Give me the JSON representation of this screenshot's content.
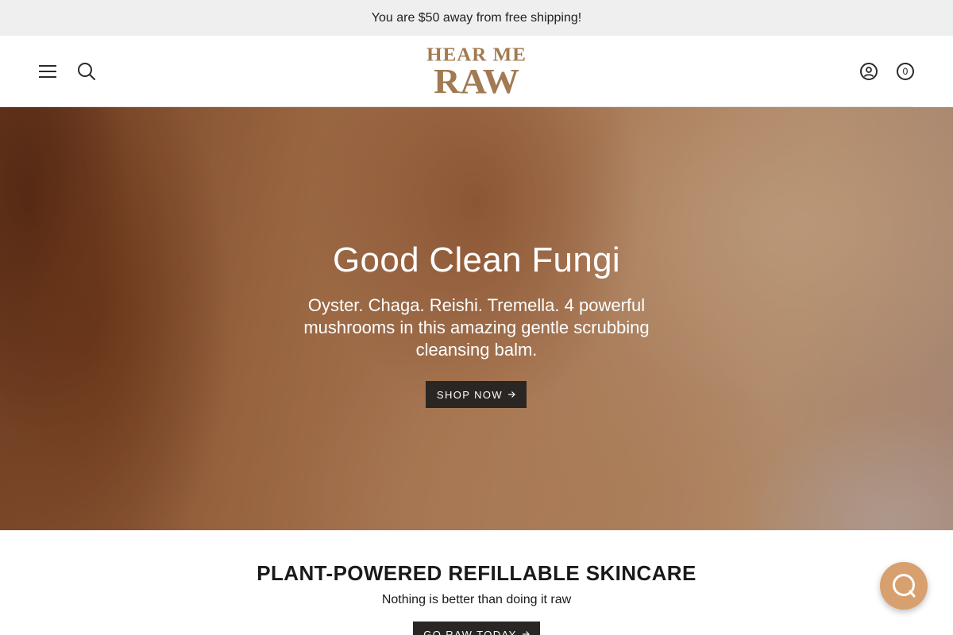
{
  "announcement": {
    "text": "You are $50 away from free shipping!"
  },
  "header": {
    "logo": {
      "line1": "HEAR ME",
      "line2": "RAW"
    },
    "cart_count": "0",
    "icons": {
      "menu": "hamburger-menu-icon",
      "search": "search-icon",
      "account": "account-icon",
      "cart": "cart-icon"
    }
  },
  "hero": {
    "title": "Good Clean Fungi",
    "subtitle": "Oyster. Chaga. Reishi. Tremella. 4 powerful mushrooms in this amazing gentle scrubbing cleansing balm.",
    "button_label": "SHOP NOW"
  },
  "promo": {
    "title": "PLANT-POWERED REFILLABLE SKINCARE",
    "subtitle": "Nothing is better than doing it raw",
    "button_label": "GO RAW TODAY"
  },
  "colors": {
    "logo": "#a27a52",
    "button": "#2a2623",
    "announcement_bg": "#efefef",
    "chat": "#d8a06e"
  }
}
